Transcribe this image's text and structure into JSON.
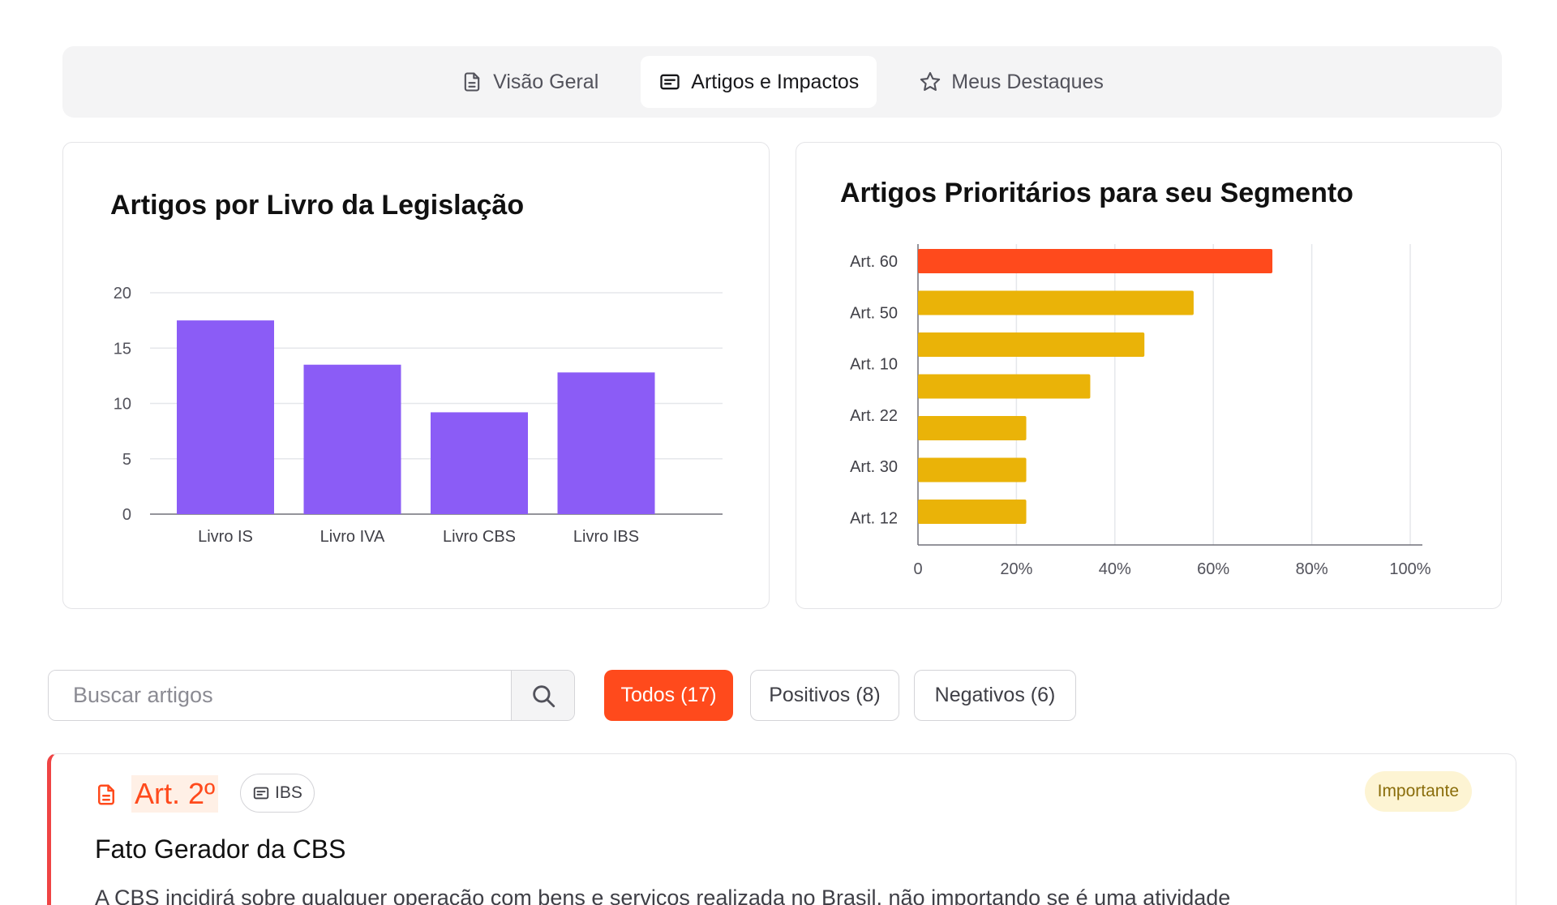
{
  "tabs": [
    {
      "label": "Visão Geral",
      "icon": "document-icon",
      "active": false
    },
    {
      "label": "Artigos e Impactos",
      "icon": "card-text-icon",
      "active": true
    },
    {
      "label": "Meus Destaques",
      "icon": "star-icon",
      "active": false
    }
  ],
  "chart_left_title": "Artigos por Livro da Legislação",
  "chart_right_title": "Artigos Prioritários para seu Segmento",
  "chart_data": [
    {
      "type": "bar",
      "title": "Artigos por Livro da Legislação",
      "categories": [
        "Livro IS",
        "Livro IVA",
        "Livro CBS",
        "Livro IBS"
      ],
      "values": [
        17.5,
        13.5,
        9.2,
        12.8
      ],
      "ylim": [
        0,
        20
      ],
      "yticks": [
        0,
        5,
        10,
        15,
        20
      ],
      "grid": true,
      "color": "#8b5cf6"
    },
    {
      "type": "bar",
      "orientation": "horizontal",
      "title": "Artigos Prioritários para seu Segmento",
      "categories": [
        "Art. 60",
        "Art. 50",
        "Art. 10",
        "Art. 22",
        "Art. 30",
        "Art. 12"
      ],
      "values": [
        72,
        56,
        46,
        35,
        22,
        22,
        22
      ],
      "xlim": [
        0,
        100
      ],
      "xticks": [
        "0",
        "20%",
        "40%",
        "60%",
        "80%",
        "100%"
      ],
      "grid": true,
      "colors": {
        "highlight": "#ff4a1c",
        "default": "#eab308"
      }
    }
  ],
  "search": {
    "placeholder": "Buscar artigos"
  },
  "filters": {
    "all": "Todos (17)",
    "positive": "Positivos (8)",
    "negative": "Negativos (6)"
  },
  "article": {
    "number": "Art. 2º",
    "tag": "IBS",
    "badge": "Importante",
    "title": "Fato Gerador da CBS",
    "description": "A CBS incidirá sobre qualquer operação com bens e serviços realizada no Brasil, não importando se é uma atividade"
  }
}
